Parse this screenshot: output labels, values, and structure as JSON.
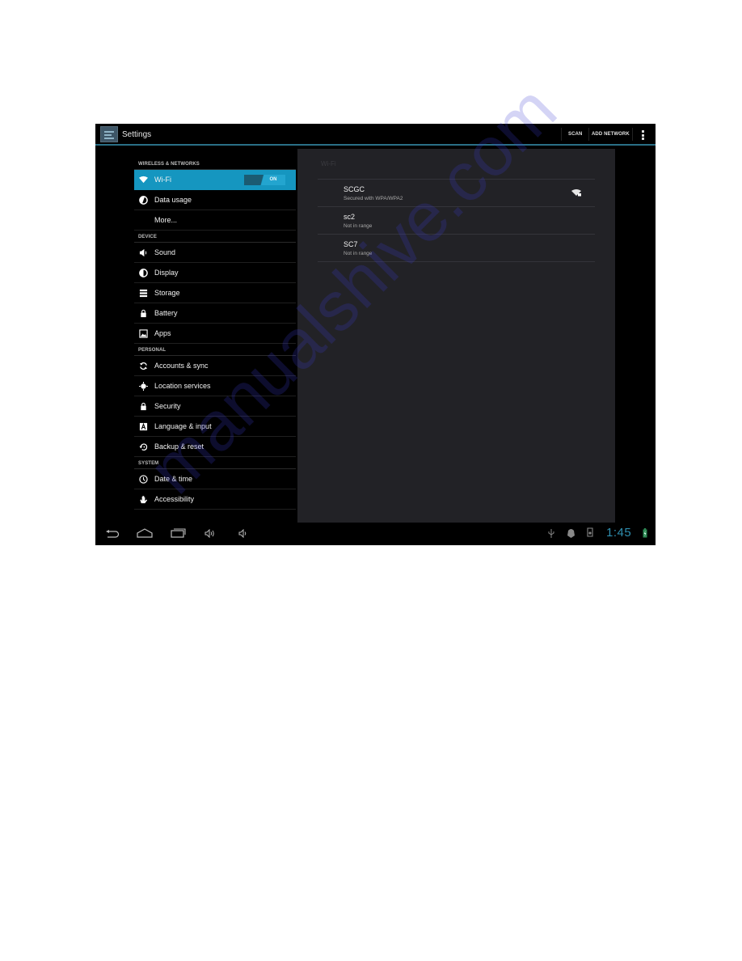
{
  "actionbar": {
    "app_icon": "settings-app-icon",
    "title": "Settings",
    "buttons": [
      {
        "label": "SCAN"
      },
      {
        "label": "ADD NETWORK"
      }
    ],
    "overflow_icon": "more-vert-icon"
  },
  "sidebar": {
    "sections": [
      {
        "header": "WIRELESS & NETWORKS",
        "items": [
          {
            "label": "Wi-Fi",
            "icon": "wifi-icon",
            "active": true,
            "toggle": "ON"
          },
          {
            "label": "Data usage",
            "icon": "data-usage-icon"
          },
          {
            "label": "More...",
            "icon": ""
          }
        ]
      },
      {
        "header": "DEVICE",
        "items": [
          {
            "label": "Sound",
            "icon": "sound-icon"
          },
          {
            "label": "Display",
            "icon": "display-icon"
          },
          {
            "label": "Storage",
            "icon": "storage-icon"
          },
          {
            "label": "Battery",
            "icon": "battery-icon"
          },
          {
            "label": "Apps",
            "icon": "apps-icon"
          }
        ]
      },
      {
        "header": "PERSONAL",
        "items": [
          {
            "label": "Accounts & sync",
            "icon": "sync-icon"
          },
          {
            "label": "Location services",
            "icon": "location-icon"
          },
          {
            "label": "Security",
            "icon": "lock-icon"
          },
          {
            "label": "Language & input",
            "icon": "language-icon"
          },
          {
            "label": "Backup & reset",
            "icon": "backup-icon"
          }
        ]
      },
      {
        "header": "SYSTEM",
        "items": [
          {
            "label": "Date & time",
            "icon": "clock-icon"
          },
          {
            "label": "Accessibility",
            "icon": "hand-icon"
          }
        ]
      }
    ]
  },
  "panel": {
    "title": "Wi-Fi",
    "networks": [
      {
        "name": "SCGC",
        "status": "Secured with WPA/WPA2",
        "signal_icon": "wifi-locked-signal-icon"
      },
      {
        "name": "sc2",
        "status": "Not in range"
      },
      {
        "name": "SC7",
        "status": "Not in range"
      }
    ]
  },
  "navbar": {
    "buttons": [
      "back-icon",
      "home-icon",
      "recent-apps-icon",
      "volume-up-icon",
      "volume-down-icon"
    ],
    "status_icons": [
      "usb-icon",
      "android-debug-icon",
      "sd-card-icon"
    ],
    "time": "1:45",
    "battery_icon": "battery-charging-icon"
  },
  "watermark": "manualshive.com",
  "colors": {
    "accent": "#1596c0",
    "actionbar_line": "#2a6f86",
    "clock": "#2f8fb0",
    "panel": "#222226"
  }
}
